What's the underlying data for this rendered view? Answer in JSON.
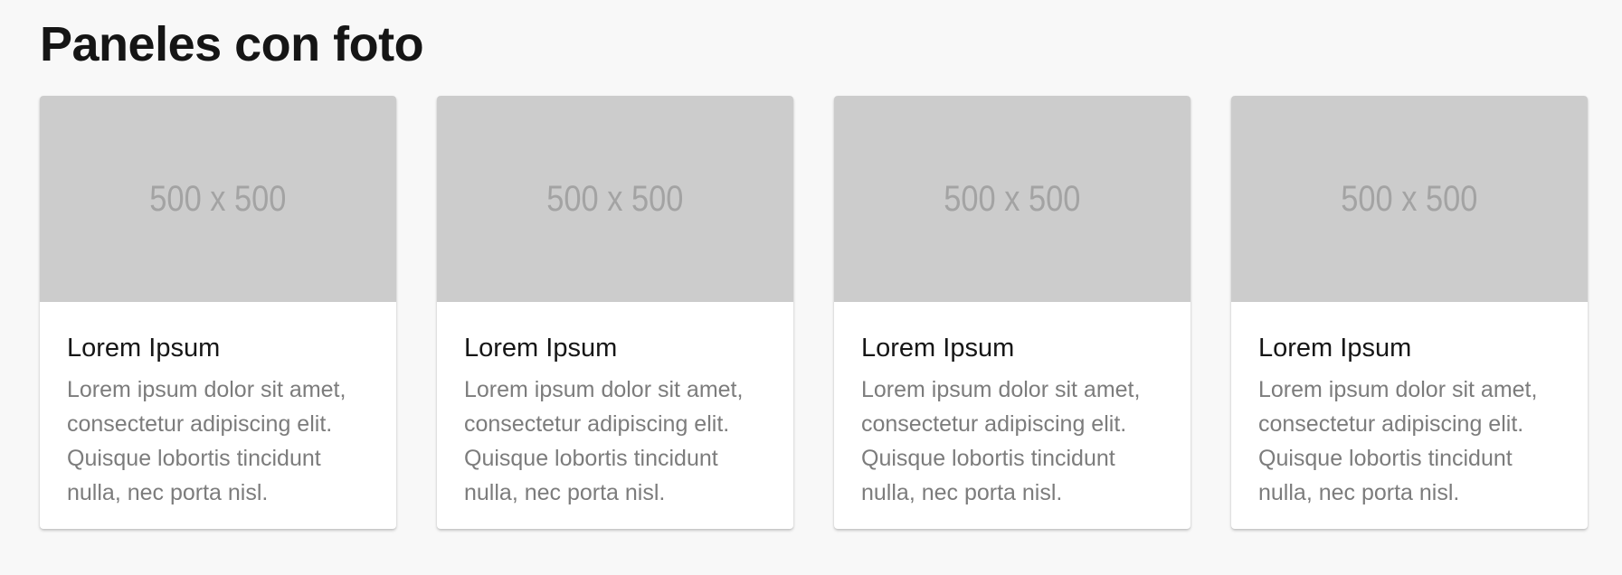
{
  "page": {
    "title": "Paneles con foto"
  },
  "colors": {
    "background": "#f8f8f8",
    "card": "#ffffff",
    "placeholder": "#cccccc",
    "placeholder_text": "#a3a3a3",
    "title_text": "#161616",
    "body_text": "#7c7c7c"
  },
  "cards": [
    {
      "photo_label": "500 x 500",
      "title": "Lorem Ipsum",
      "text": "Lorem ipsum dolor sit amet, consectetur adipiscing elit. Quisque lobortis tincidunt nulla, nec porta nisl."
    },
    {
      "photo_label": "500 x 500",
      "title": "Lorem Ipsum",
      "text": "Lorem ipsum dolor sit amet, consectetur adipiscing elit. Quisque lobortis tincidunt nulla, nec porta nisl."
    },
    {
      "photo_label": "500 x 500",
      "title": "Lorem Ipsum",
      "text": "Lorem ipsum dolor sit amet, consectetur adipiscing elit. Quisque lobortis tincidunt nulla, nec porta nisl."
    },
    {
      "photo_label": "500 x 500",
      "title": "Lorem Ipsum",
      "text": "Lorem ipsum dolor sit amet, consectetur adipiscing elit. Quisque lobortis tincidunt nulla, nec porta nisl."
    }
  ]
}
